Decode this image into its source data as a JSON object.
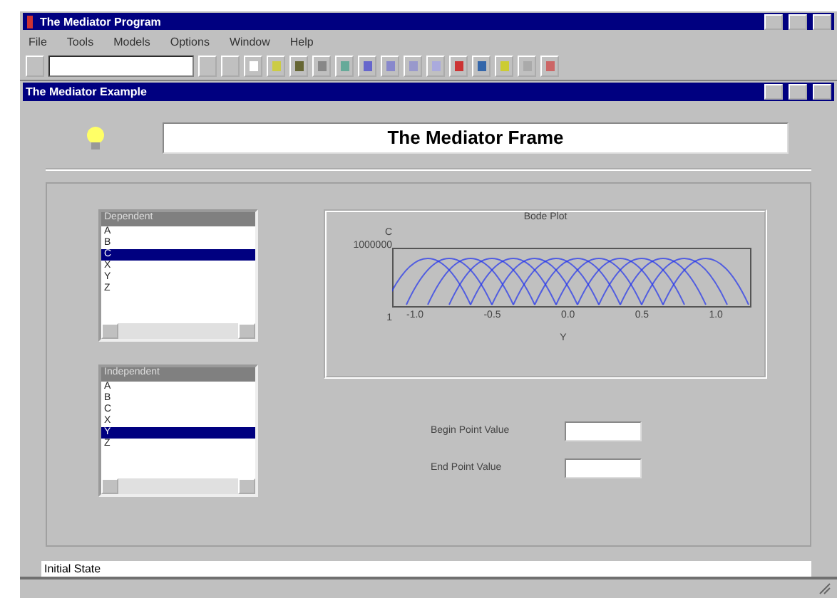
{
  "app_window": {
    "title": "The Mediator Program"
  },
  "menu": [
    "File",
    "Tools",
    "Models",
    "Options",
    "Window",
    "Help"
  ],
  "child_window": {
    "title": "The Mediator Example"
  },
  "frame_title": "The Mediator Frame",
  "lists": [
    {
      "title": "Dependent",
      "items": [
        {
          "label": "A",
          "selected": false
        },
        {
          "label": "B",
          "selected": false
        },
        {
          "label": "C",
          "selected": true
        },
        {
          "label": "X",
          "selected": false
        },
        {
          "label": "Y",
          "selected": false
        },
        {
          "label": "Z",
          "selected": false
        }
      ]
    },
    {
      "title": "Independent",
      "items": [
        {
          "label": "A",
          "selected": false
        },
        {
          "label": "B",
          "selected": false
        },
        {
          "label": "C",
          "selected": false
        },
        {
          "label": "X",
          "selected": false
        },
        {
          "label": "Y",
          "selected": true
        },
        {
          "label": "Z",
          "selected": false
        }
      ]
    }
  ],
  "plot": {
    "title": "Bode Plot",
    "y_label": "C",
    "y_ticks": [
      "1000000",
      "1"
    ],
    "x_ticks": [
      "-1.0",
      "-0.5",
      "0.0",
      "0.5",
      "1.0"
    ],
    "x_label": "Y"
  },
  "fields": [
    {
      "label": "Begin Point Value"
    },
    {
      "label": "End Point Value"
    }
  ],
  "status": "Initial State"
}
